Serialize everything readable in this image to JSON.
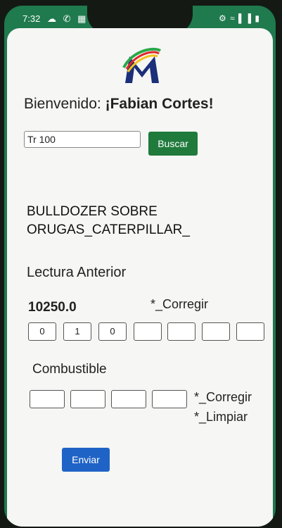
{
  "status_bar": {
    "time": "7:32",
    "left_icons": [
      "cloud-icon",
      "whatsapp-icon",
      "app-icon",
      "dot-icon"
    ],
    "right_icons": [
      "battery-saver-icon",
      "wifi-icon",
      "signal-icon",
      "battery-icon"
    ],
    "right_glyphs": "⚙ ≈ ▌▐ ▮"
  },
  "colors": {
    "phone_frame": "#1f7a4e",
    "search_button": "#1f7a3c",
    "send_button": "#1f63c6",
    "logo_colors": [
      "#1b2f7a",
      "#2aa84a",
      "#e0262a",
      "#f2c21b"
    ]
  },
  "header": {
    "logo": "M-logo"
  },
  "welcome": {
    "prefix": "Bienvenido:",
    "name": "¡Fabian Cortes!"
  },
  "search": {
    "value": "Tr 100",
    "button_label": "Buscar"
  },
  "machine": {
    "line1": "BULLDOZER SOBRE",
    "line2": "ORUGAS_CATERPILLAR_"
  },
  "lectura": {
    "label": "Lectura Anterior",
    "value": "10250.0",
    "corregir": "*_Corregir",
    "digits": [
      "0",
      "1",
      "0",
      "",
      "",
      "",
      ""
    ]
  },
  "combustible": {
    "label": "Combustible",
    "digits": [
      "",
      "",
      "",
      ""
    ],
    "corregir": "*_Corregir",
    "limpiar": "*_Limpiar"
  },
  "actions": {
    "send_label": "Enviar"
  }
}
